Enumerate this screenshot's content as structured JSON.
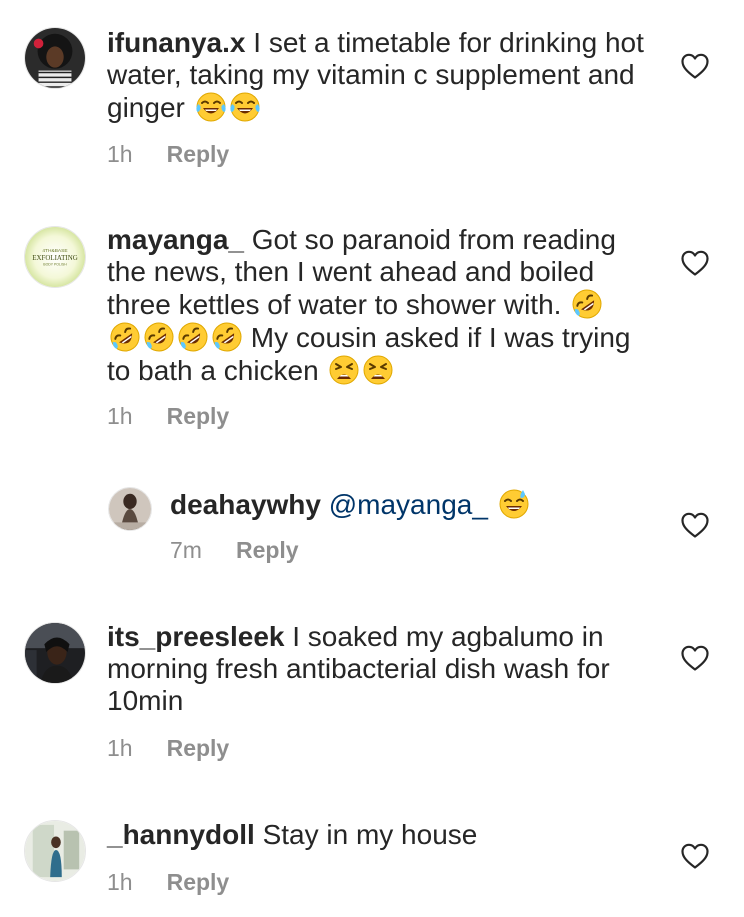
{
  "comments": [
    {
      "username": "ifunanya.x",
      "text": "I set a timetable for drinking hot water, taking my vitamin c supplement and ginger",
      "time": "1h",
      "reply_label": "Reply"
    },
    {
      "username": "mayanga_",
      "text_1": "Got so paranoid from reading the news, then I went ahead and boiled three kettles of water to shower with.",
      "text_2": "My cousin asked if I was trying to bath a chicken",
      "time": "1h",
      "reply_label": "Reply",
      "avatar_logo": {
        "line1": "4TH&BASE",
        "line2": "EXFOLIATING",
        "line3": "BODY POLISH"
      }
    },
    {
      "username": "deahaywhy",
      "mention": "@mayanga_",
      "time": "7m",
      "reply_label": "Reply"
    },
    {
      "username": "its_preesleek",
      "text": "I soaked my agbalumo in morning fresh antibacterial dish wash for 10min",
      "time": "1h",
      "reply_label": "Reply"
    },
    {
      "username": "_hannydoll",
      "text": "Stay in my house",
      "time": "1h",
      "reply_label": "Reply"
    }
  ],
  "icons": {
    "like": "heart-outline-icon",
    "tears_of_joy": "face-with-tears-of-joy-emoji",
    "rofl": "rolling-on-floor-laughing-emoji",
    "tired": "tired-face-emoji",
    "sweat_smile": "grinning-face-with-sweat-emoji"
  },
  "colors": {
    "text": "#262626",
    "meta": "#8e8e8e",
    "mention": "#003569",
    "emoji_yellow": "#ffcc33"
  }
}
